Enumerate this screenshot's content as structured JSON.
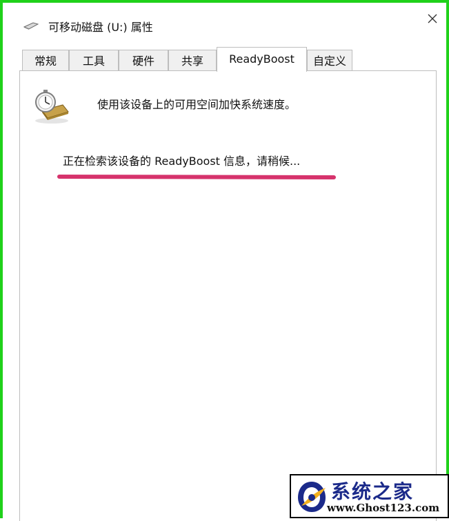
{
  "window": {
    "title": "可移动磁盘 (U:) 属性",
    "close_glyph": "✕"
  },
  "tabs": [
    {
      "label": "常规",
      "active": false
    },
    {
      "label": "工具",
      "active": false
    },
    {
      "label": "硬件",
      "active": false
    },
    {
      "label": "共享",
      "active": false
    },
    {
      "label": "ReadyBoost",
      "active": true
    },
    {
      "label": "自定义",
      "active": false
    }
  ],
  "readyboost": {
    "icon": "stopwatch-usb-drive-icon",
    "description": "使用该设备上的可用空间加快系统速度。",
    "status": "正在检索该设备的 ReadyBoost 信息，请稍候..."
  },
  "watermark": {
    "title": "系统之家",
    "url": "www.Ghost123.com"
  },
  "colors": {
    "frame_green": "#1fd11a",
    "annotation_pink": "#d6336c",
    "watermark_blue": "#1b2a8a"
  }
}
